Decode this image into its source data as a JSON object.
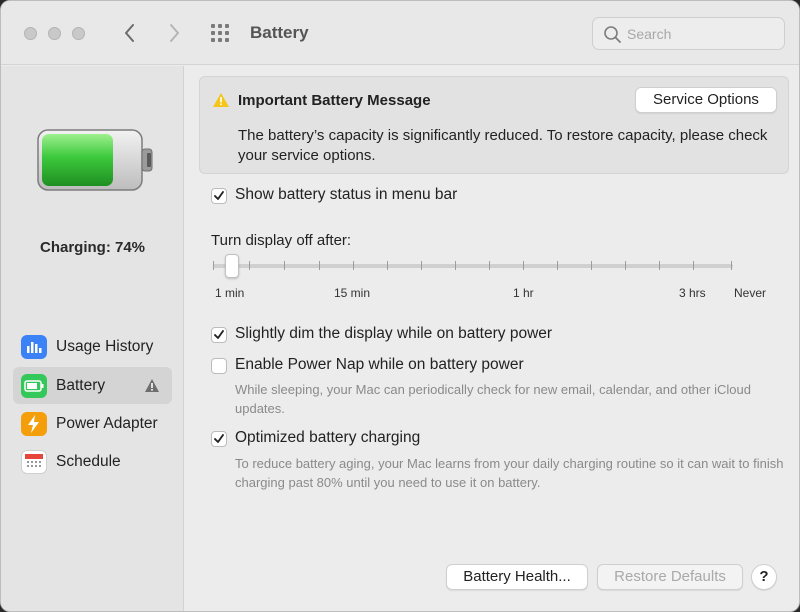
{
  "window": {
    "title": "Battery",
    "search": {
      "placeholder": "Search",
      "value": ""
    }
  },
  "sidebar": {
    "charging_text": "Charging: 74%",
    "charge_level": 0.74,
    "items": [
      {
        "label": "Usage History",
        "icon": "bar-chart-icon",
        "color": "#3b82f6"
      },
      {
        "label": "Battery",
        "icon": "battery-icon",
        "color": "#34c759",
        "active": true,
        "warning": true
      },
      {
        "label": "Power Adapter",
        "icon": "lightning-icon",
        "color": "#f59e0b"
      },
      {
        "label": "Schedule",
        "icon": "calendar-icon",
        "color": "#ffffff"
      }
    ]
  },
  "message": {
    "title": "Important Battery Message",
    "body": "The battery’s capacity is significantly reduced. To restore capacity, please check your service options.",
    "button": "Service Options"
  },
  "options": {
    "menu_bar": {
      "label": "Show battery status in menu bar",
      "checked": true
    },
    "display_off": {
      "label": "Turn display off after:",
      "ticks": [
        "1 min",
        "15 min",
        "1 hr",
        "3 hrs",
        "Never"
      ]
    },
    "dim_display": {
      "label": "Slightly dim the display while on battery power",
      "checked": true
    },
    "power_nap": {
      "label": "Enable Power Nap while on battery power",
      "checked": false,
      "description": "While sleeping, your Mac can periodically check for new email, calendar, and other iCloud updates."
    },
    "optimized": {
      "label": "Optimized battery charging",
      "checked": true,
      "description": "To reduce battery aging, your Mac learns from your daily charging routine so it can wait to finish charging past 80% until you need to use it on battery."
    }
  },
  "footer": {
    "battery_health": "Battery Health...",
    "restore_defaults": "Restore Defaults",
    "help": "?"
  },
  "colors": {
    "warning": "#f5c518",
    "battery_green": "#3cc83c"
  }
}
